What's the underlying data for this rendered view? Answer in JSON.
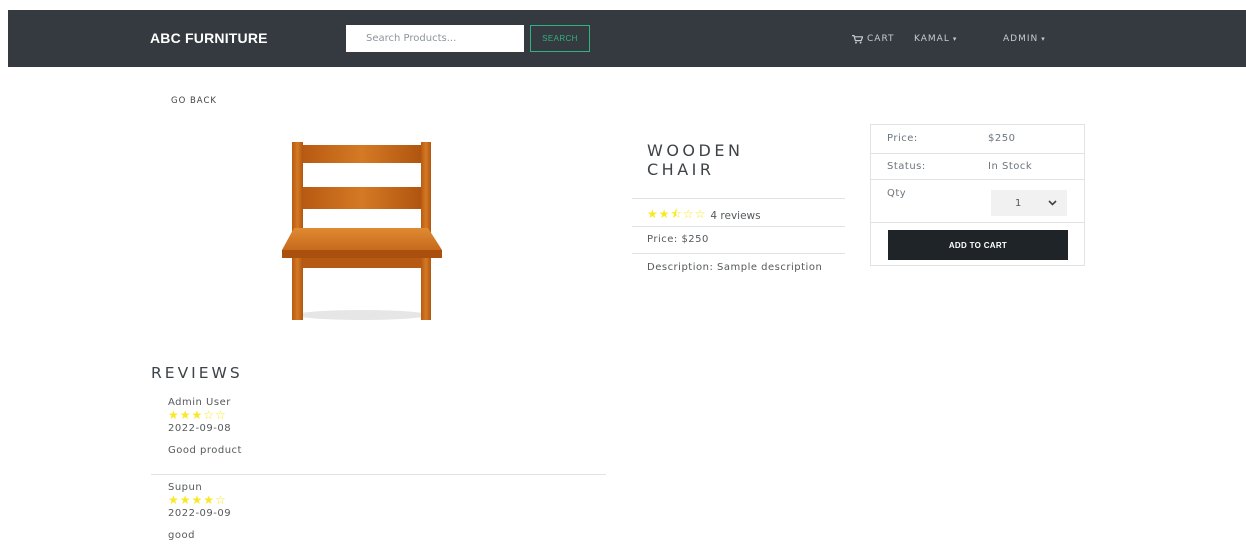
{
  "header": {
    "brand": "ABC FURNITURE",
    "search_placeholder": "Search Products...",
    "search_button": "SEARCH",
    "cart_label": "CART",
    "user_menu": "KAMAL",
    "admin_menu": "ADMIN"
  },
  "nav": {
    "go_back": "GO BACK"
  },
  "product": {
    "name": "WOODEN CHAIR",
    "rating": 2.5,
    "stars": "★★⯪☆☆",
    "reviews_text": "4 reviews",
    "price_line": "Price: $250",
    "description_line": "Description: Sample description",
    "image_icon": "wooden-chair-image"
  },
  "purchase_card": {
    "price_label": "Price:",
    "price_value": "$250",
    "status_label": "Status:",
    "status_value": "In Stock",
    "qty_label": "Qty",
    "qty_value": "1",
    "add_to_cart": "ADD TO CART"
  },
  "reviews": {
    "title": "REVIEWS",
    "items": [
      {
        "name": "Admin User",
        "rating": 3,
        "stars": "★★★☆☆",
        "date": "2022-09-08",
        "comment": "Good product"
      },
      {
        "name": "Supun",
        "rating": 4,
        "stars": "★★★★☆",
        "date": "2022-09-09",
        "comment": "good"
      }
    ]
  },
  "colors": {
    "navbar": "#343a40",
    "search_accent": "#2fb380",
    "star": "#f8e825",
    "button_dark": "#1f2428"
  }
}
